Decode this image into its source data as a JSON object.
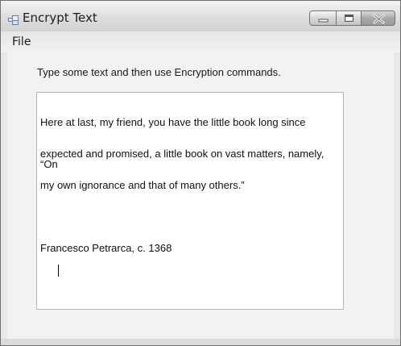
{
  "window": {
    "title": "Encrypt Text",
    "icon": "application-icon",
    "controls": [
      "minimize-icon",
      "maximize-icon",
      "close-icon"
    ]
  },
  "menu": {
    "items": [
      {
        "label": "File"
      }
    ]
  },
  "main": {
    "instruction": "Type some text and then use Encryption commands.",
    "text_lines": [
      "Here at last, my friend, you have the little book long since",
      "expected and promised, a little book on vast matters, namely, “On",
      "my own ignorance and that of many others.”",
      "",
      "Francesco Petrarca, c. 1368"
    ]
  }
}
